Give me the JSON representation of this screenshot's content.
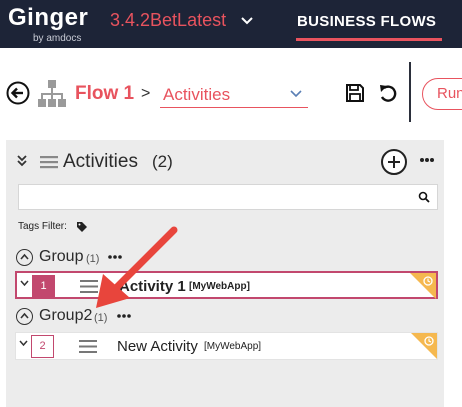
{
  "topbar": {
    "logo": "Ginger",
    "logo_sub": "by amdocs",
    "version": "3.4.2BetLatest",
    "section": "BUSINESS FLOWS"
  },
  "breadcrumb": {
    "flow_name": "Flow 1",
    "separator": ">",
    "view_selected": "Activities",
    "run_label": "Run"
  },
  "activities_panel": {
    "title": "Activities",
    "count": "(2)",
    "search_placeholder": "",
    "tags_label": "Tags Filter:",
    "groups": [
      {
        "name": "Group",
        "count": "(1)",
        "activities": [
          {
            "index": "1",
            "name": "Activity 1",
            "target": "[MyWebApp]",
            "selected": true
          }
        ]
      },
      {
        "name": "Group2",
        "count": "(1)",
        "activities": [
          {
            "index": "2",
            "name": "New Activity",
            "target": "[MyWebApp]",
            "selected": false
          }
        ]
      }
    ]
  },
  "colors": {
    "topbar_bg": "#1d2437",
    "accent": "#e8535e",
    "selected_row": "#c2486e",
    "corner_badge": "#f5b84f",
    "arrow": "#e8453c"
  }
}
